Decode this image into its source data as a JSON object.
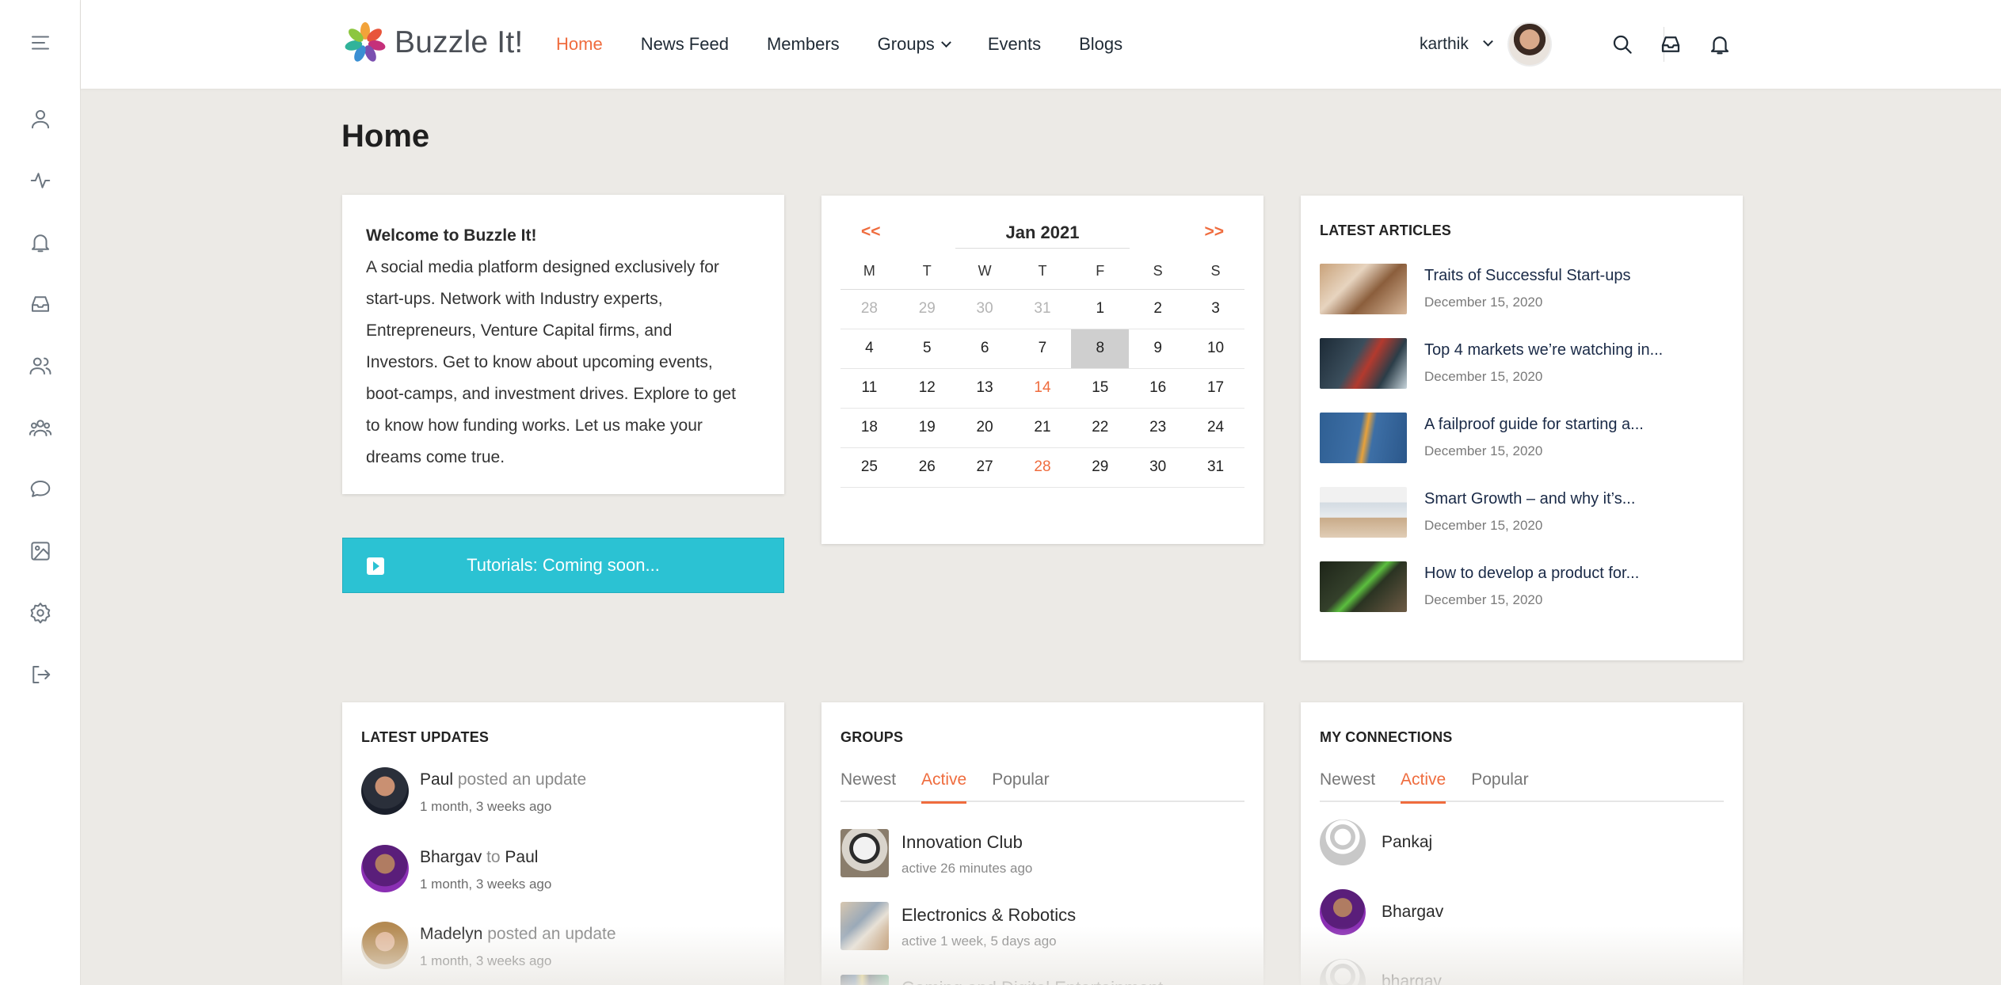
{
  "brand": {
    "name": "Buzzle It!"
  },
  "nav": [
    {
      "label": "Home",
      "active": true
    },
    {
      "label": "News Feed"
    },
    {
      "label": "Members"
    },
    {
      "label": "Groups",
      "dropdown": true
    },
    {
      "label": "Events"
    },
    {
      "label": "Blogs"
    }
  ],
  "user": {
    "name": "karthik"
  },
  "colors": {
    "accent": "#ef6c3e",
    "tutorial": "#2bc2d3",
    "text": "#1f2a35"
  },
  "page": {
    "title": "Home"
  },
  "welcome": {
    "title": "Welcome to Buzzle It!",
    "lines": [
      "A social media platform designed exclusively for",
      "start-ups. Network with Industry experts,",
      "Entrepreneurs, Venture Capital firms, and",
      "Investors. Get to know about upcoming events,",
      "boot-camps, and investment drives. Explore to get",
      "to know how funding works. Let us make your",
      "dreams come true."
    ]
  },
  "tutorial": {
    "label": "Tutorials: Coming soon..."
  },
  "calendar": {
    "prev": "<<",
    "next": ">>",
    "month": "Jan 2021",
    "weekdays": [
      "M",
      "T",
      "W",
      "T",
      "F",
      "S",
      "S"
    ],
    "weeks": [
      [
        "28",
        "29",
        "30",
        "31",
        "1",
        "2",
        "3"
      ],
      [
        "4",
        "5",
        "6",
        "7",
        "8",
        "9",
        "10"
      ],
      [
        "11",
        "12",
        "13",
        "14",
        "15",
        "16",
        "17"
      ],
      [
        "18",
        "19",
        "20",
        "21",
        "22",
        "23",
        "24"
      ],
      [
        "25",
        "26",
        "27",
        "28",
        "29",
        "30",
        "31"
      ]
    ]
  },
  "articles": {
    "title": "LATEST ARTICLES",
    "items": [
      {
        "title": "Traits of Successful Start-ups",
        "date": "December 15, 2020"
      },
      {
        "title": "Top 4 markets we’re watching in...",
        "date": "December 15, 2020"
      },
      {
        "title": "A failproof guide for starting a...",
        "date": "December 15, 2020"
      },
      {
        "title": "Smart Growth – and why it’s...",
        "date": "December 15, 2020"
      },
      {
        "title": "How to develop a product for...",
        "date": "December 15, 2020"
      }
    ]
  },
  "updates": {
    "title": "LATEST UPDATES",
    "items": [
      {
        "name": "Paul",
        "action": "posted an update",
        "target": "",
        "time": "1 month, 3 weeks ago"
      },
      {
        "name": "Bhargav",
        "action": "to",
        "target": "Paul",
        "time": "1 month, 3 weeks ago"
      },
      {
        "name": "Madelyn",
        "action": "posted an update",
        "target": "",
        "time": "1 month, 3 weeks ago"
      }
    ]
  },
  "groups": {
    "title": "GROUPS",
    "tabs": [
      "Newest",
      "Active",
      "Popular"
    ],
    "items": [
      {
        "name": "Innovation Club",
        "meta": "active 26 minutes ago"
      },
      {
        "name": "Electronics & Robotics",
        "meta": "active 1 week, 5 days ago"
      },
      {
        "name": "Gaming and Digital Entertainment",
        "meta": ""
      }
    ]
  },
  "connections": {
    "title": "MY CONNECTIONS",
    "tabs": [
      "Newest",
      "Active",
      "Popular"
    ],
    "items": [
      {
        "name": "Pankaj"
      },
      {
        "name": "Bhargav"
      },
      {
        "name": "bhargav"
      }
    ]
  }
}
